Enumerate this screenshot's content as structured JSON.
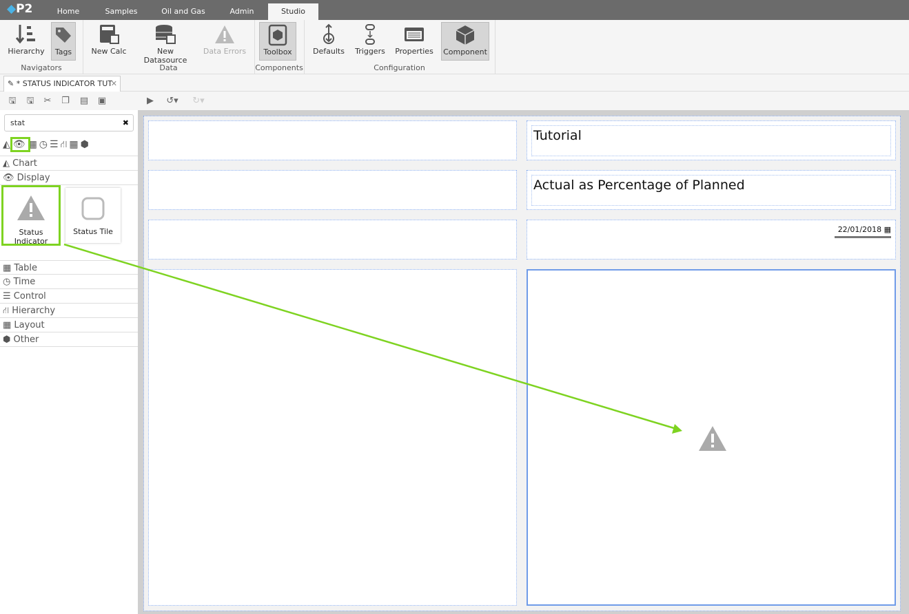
{
  "app": {
    "logo": "P2",
    "tabs": [
      "Home",
      "Samples",
      "Oil and Gas",
      "Admin",
      "Studio"
    ],
    "active_tab": "Studio"
  },
  "ribbon": {
    "buttons": [
      {
        "label": "Hierarchy",
        "icon": "hierarchy-icon"
      },
      {
        "label": "Tags",
        "icon": "tag-icon"
      },
      {
        "label": "New Calc",
        "icon": "calculator-icon"
      },
      {
        "label": "New Datasource",
        "icon": "database-icon"
      },
      {
        "label": "Data Errors",
        "icon": "warning-icon"
      },
      {
        "label": "Toolbox",
        "icon": "toolbox-icon"
      },
      {
        "label": "Defaults",
        "icon": "defaults-icon"
      },
      {
        "label": "Triggers",
        "icon": "triggers-icon"
      },
      {
        "label": "Properties",
        "icon": "properties-icon"
      },
      {
        "label": "Component",
        "icon": "cube-icon"
      }
    ],
    "groups": [
      "Navigators",
      "Data",
      "Components",
      "Configuration"
    ]
  },
  "document_tab": {
    "label": "* STATUS INDICATOR TUT"
  },
  "toolbox": {
    "search_value": "stat",
    "categories": [
      "Chart",
      "Display",
      "Table",
      "Time",
      "Control",
      "Hierarchy",
      "Layout",
      "Other"
    ],
    "display_items": [
      "Status Indicator",
      "Status Tile"
    ]
  },
  "canvas": {
    "title": "Tutorial",
    "subtitle": "Actual as Percentage of Planned",
    "date": "22/01/2018"
  },
  "colors": {
    "highlight": "#7ed321",
    "selection": "#6f9be8"
  }
}
